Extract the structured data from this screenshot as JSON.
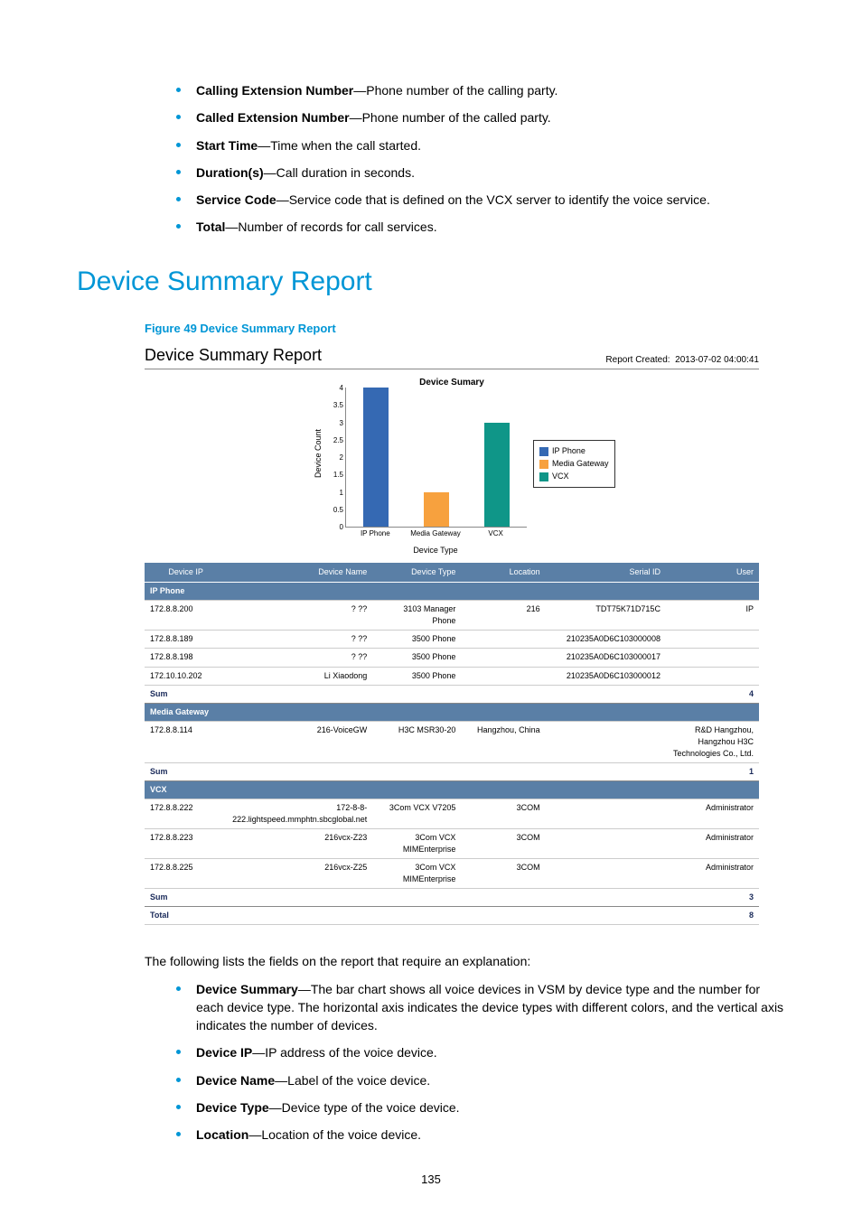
{
  "top_fields": [
    {
      "term": "Calling Extension Number",
      "desc": "—Phone number of the calling party."
    },
    {
      "term": "Called Extension Number",
      "desc": "—Phone number of the called party."
    },
    {
      "term": "Start Time",
      "desc": "—Time when the call started."
    },
    {
      "term": "Duration(s)",
      "desc": "—Call duration in seconds."
    },
    {
      "term": "Service Code",
      "desc": "—Service code that is defined on the VCX server to identify the voice service."
    },
    {
      "term": "Total",
      "desc": "—Number of records for call services."
    }
  ],
  "section_heading": "Device Summary Report",
  "figure_caption": "Figure 49 Device Summary Report",
  "report": {
    "title": "Device Summary Report",
    "created_label": "Report Created:",
    "created_value": "2013-07-02 04:00:41"
  },
  "chart_data": {
    "type": "bar",
    "title": "Device Sumary",
    "xlabel": "Device Type",
    "ylabel": "Device Count",
    "ylim": [
      0,
      4
    ],
    "yticks": [
      0,
      0.5,
      1,
      1.5,
      2,
      2.5,
      3,
      3.5,
      4
    ],
    "categories": [
      "IP Phone",
      "Media Gateway",
      "VCX"
    ],
    "values": [
      4,
      1,
      3
    ],
    "series": [
      {
        "name": "IP Phone",
        "color": "#3569b3"
      },
      {
        "name": "Media Gateway",
        "color": "#f7a13e"
      },
      {
        "name": "VCX",
        "color": "#0f9688"
      }
    ]
  },
  "table": {
    "headers": [
      "Device IP",
      "Device Name",
      "Device Type",
      "Location",
      "Serial ID",
      "User"
    ],
    "groups": [
      {
        "name": "IP Phone",
        "rows": [
          {
            "ip": "172.8.8.200",
            "name": "? ??",
            "type": "3103 Manager Phone",
            "loc": "216",
            "serial": "TDT75K71D715C",
            "user": "IP"
          },
          {
            "ip": "172.8.8.189",
            "name": "? ??",
            "type": "3500 Phone",
            "loc": "",
            "serial": "210235A0D6C103000008",
            "user": ""
          },
          {
            "ip": "172.8.8.198",
            "name": "? ??",
            "type": "3500 Phone",
            "loc": "",
            "serial": "210235A0D6C103000017",
            "user": ""
          },
          {
            "ip": "172.10.10.202",
            "name": "Li Xiaodong",
            "type": "3500 Phone",
            "loc": "",
            "serial": "210235A0D6C103000012",
            "user": ""
          }
        ],
        "sum": "4"
      },
      {
        "name": "Media Gateway",
        "rows": [
          {
            "ip": "172.8.8.114",
            "name": "216-VoiceGW",
            "type": "H3C MSR30-20",
            "loc": "Hangzhou, China",
            "serial": "",
            "user": "R&D Hangzhou, Hangzhou H3C Technologies Co., Ltd."
          }
        ],
        "sum": "1"
      },
      {
        "name": "VCX",
        "rows": [
          {
            "ip": "172.8.8.222",
            "name": "172-8-8-222.lightspeed.mmphtn.sbcglobal.net",
            "type": "3Com VCX V7205",
            "loc": "3COM",
            "serial": "",
            "user": "Administrator"
          },
          {
            "ip": "172.8.8.223",
            "name": "216vcx-Z23",
            "type": "3Com VCX MIMEnterprise",
            "loc": "3COM",
            "serial": "",
            "user": "Administrator"
          },
          {
            "ip": "172.8.8.225",
            "name": "216vcx-Z25",
            "type": "3Com VCX MIMEnterprise",
            "loc": "3COM",
            "serial": "",
            "user": "Administrator"
          }
        ],
        "sum": "3"
      }
    ],
    "sum_label": "Sum",
    "total_label": "Total",
    "total_value": "8"
  },
  "explain_intro": "The following lists the fields on the report that require an explanation:",
  "bottom_fields": [
    {
      "term": "Device Summary",
      "desc": "—The bar chart shows all voice devices in VSM by device type and the number for each device type. The horizontal axis indicates the device types with different colors, and the vertical axis indicates the number of devices."
    },
    {
      "term": "Device IP",
      "desc": "—IP address of the voice device."
    },
    {
      "term": "Device Name",
      "desc": "—Label of the voice device."
    },
    {
      "term": "Device Type",
      "desc": "—Device type of the voice device."
    },
    {
      "term": "Location",
      "desc": "—Location of the voice device."
    }
  ],
  "page_number": "135"
}
